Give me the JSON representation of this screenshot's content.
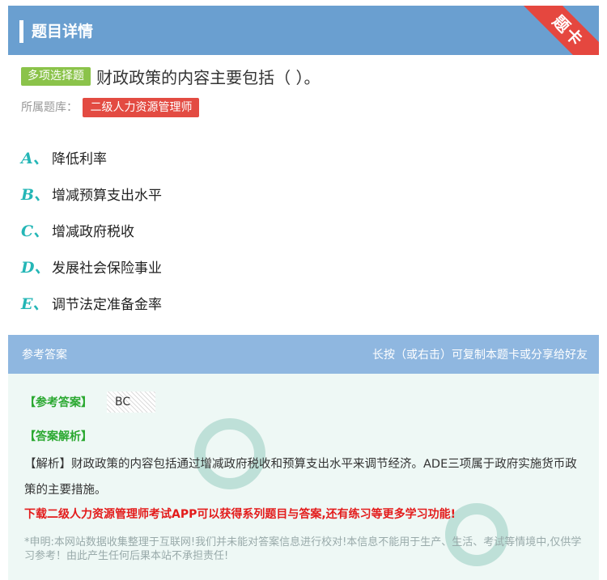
{
  "header": {
    "title": "题目详情",
    "ribbon": "题卡"
  },
  "question": {
    "type_badge": "多项选择题",
    "text": "财政政策的内容主要包括（ ）。",
    "bank_label": "所属题库：",
    "bank_name": "二级人力资源管理师"
  },
  "options": [
    {
      "letter": "A、",
      "text": "降低利率"
    },
    {
      "letter": "B、",
      "text": "增减预算支出水平"
    },
    {
      "letter": "C、",
      "text": "增减政府税收"
    },
    {
      "letter": "D、",
      "text": "发展社会保险事业"
    },
    {
      "letter": "E、",
      "text": "调节法定准备金率"
    }
  ],
  "answer": {
    "section_title": "参考答案",
    "share_hint": "长按（或右击）可复制本题卡或分享给好友",
    "answer_label": "【参考答案】",
    "answer_value": "BC",
    "explain_label": "【答案解析】",
    "explain_text": "【解析】财政政策的内容包括通过增减政府税收和预算支出水平来调节经济。ADE三项属于政府实施货币政策的主要措施。",
    "promo": "下载二级人力资源管理师考试APP可以获得系列题目与答案,还有练习等更多学习功能!",
    "disclaimer": "*申明:本网站数据收集整理于互联网!我们并未能对答案信息进行校对!本信息不能用于生产、生活、考试等情境中,仅供学习参考！由此产生任何后果本站不承担责任!"
  },
  "colors": {
    "header_bg": "#6a9fd0",
    "ribbon": "#e5473f",
    "badge_green": "#8bc34a",
    "bank_red": "#e34b42",
    "option_letter": "#24b6b6",
    "answer_head_bg": "#8fb7e0",
    "answer_body_bg": "#eef8f5",
    "label_green": "#2aa830",
    "promo_red": "#e31b1b"
  }
}
